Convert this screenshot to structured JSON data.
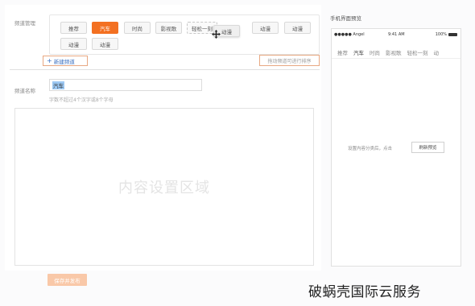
{
  "channel_manage": {
    "label": "频道管理",
    "tags": [
      "推荐",
      "汽车",
      "时尚",
      "影视歌",
      "轻松一刻",
      "动漫",
      "动漫",
      "动漫",
      "动漫",
      "动漫"
    ],
    "active_tag": "汽车",
    "new_channel_label": "新建频道",
    "drag_hint": "拖动频道可进行排序"
  },
  "channel_name": {
    "label": "频道名称",
    "value": "汽车",
    "hint": "字数不超过4个汉字或8个字母"
  },
  "content_area": {
    "placeholder": "内容设置区域"
  },
  "save_button": "保存并发布",
  "preview": {
    "title": "手机界面预览",
    "status": {
      "carrier": "●●●●● Angel",
      "time": "9:41 AM",
      "battery": "100%"
    },
    "tabs": [
      "推荐",
      "汽车",
      "时尚",
      "影视歌",
      "轻松一刻",
      "动"
    ],
    "active_tab": "汽车",
    "message": "设置内容分类后，点击",
    "refresh_button": "刷新预览"
  },
  "watermark": "破蜗壳国际云服务",
  "colors": {
    "accent": "#f37021",
    "save_button_bg": "#f9c8a8",
    "selection": "#9cc8f3"
  },
  "icons": [
    "plus-icon",
    "move-cursor-icon",
    "wifi-icon",
    "battery-icon"
  ]
}
